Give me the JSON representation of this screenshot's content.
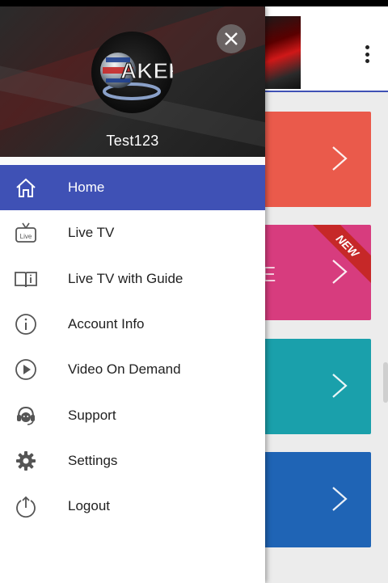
{
  "drawer": {
    "username": "Test123",
    "logo_text": "AKER",
    "items": [
      {
        "label": "Home",
        "icon": "home-icon",
        "active": true
      },
      {
        "label": "Live TV",
        "icon": "live-tv-icon",
        "active": false
      },
      {
        "label": "Live TV with Guide",
        "icon": "book-guide-icon",
        "active": false
      },
      {
        "label": "Account Info",
        "icon": "info-icon",
        "active": false
      },
      {
        "label": "Video On Demand",
        "icon": "play-circle-icon",
        "active": false
      },
      {
        "label": "Support",
        "icon": "support-headset-icon",
        "active": false
      },
      {
        "label": "Settings",
        "icon": "gear-icon",
        "active": false
      },
      {
        "label": "Logout",
        "icon": "logout-icon",
        "active": false
      }
    ]
  },
  "background": {
    "tiles": [
      {
        "color": "#ea5a4b",
        "fragment": ""
      },
      {
        "color": "#d73c7e",
        "fragment": "E",
        "badge": "NEW"
      },
      {
        "color": "#1aa0ab",
        "fragment": ""
      },
      {
        "color": "#1f64b5",
        "fragment": ""
      }
    ]
  },
  "colors": {
    "accent": "#3f51b5",
    "icon_gray": "#555555"
  }
}
